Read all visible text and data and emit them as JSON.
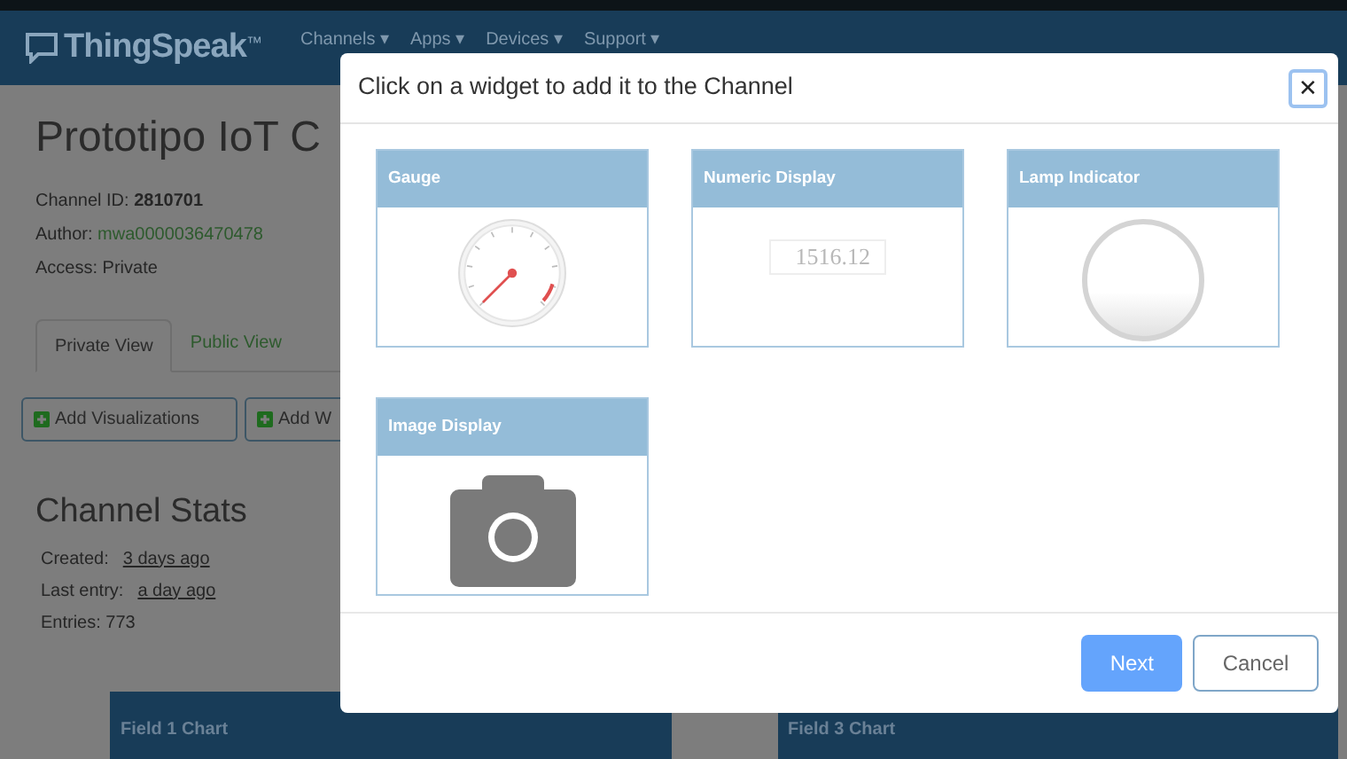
{
  "navbar": {
    "brand": "ThingSpeak",
    "trademark": "™",
    "menu": [
      {
        "label": "Channels ▾"
      },
      {
        "label": "Apps ▾"
      },
      {
        "label": "Devices ▾"
      },
      {
        "label": "Support ▾"
      }
    ]
  },
  "channel": {
    "title": "Prototipo IoT C",
    "id_label": "Channel ID:",
    "id": "2810701",
    "author_label": "Author:",
    "author": "mwa0000036470478",
    "access": "Access: Private"
  },
  "tabs": [
    {
      "label": "Private View",
      "selected": true
    },
    {
      "label": "Public View",
      "selected": false
    }
  ],
  "actions": [
    {
      "label": "Add Visualizations"
    },
    {
      "label": "Add W"
    }
  ],
  "stats": {
    "title": "Channel Stats",
    "created_label": "Created:",
    "created": "3 days ago",
    "last_label": "Last entry:",
    "last": "a day ago",
    "entries": "Entries: 773"
  },
  "field_charts": [
    {
      "title": "Field 1 Chart"
    },
    {
      "title": "Field 3 Chart"
    }
  ],
  "dialog": {
    "title": "Click on a widget to add it to the Channel",
    "close": "✕",
    "widgets": [
      {
        "kind": "gauge",
        "title": "Gauge"
      },
      {
        "kind": "numeric",
        "title": "Numeric Display",
        "value": "1516.12"
      },
      {
        "kind": "lamp",
        "title": "Lamp Indicator"
      },
      {
        "kind": "image",
        "title": "Image Display"
      }
    ],
    "buttons": [
      {
        "label": "Next",
        "primary": true
      },
      {
        "label": "Cancel",
        "primary": false
      }
    ]
  }
}
